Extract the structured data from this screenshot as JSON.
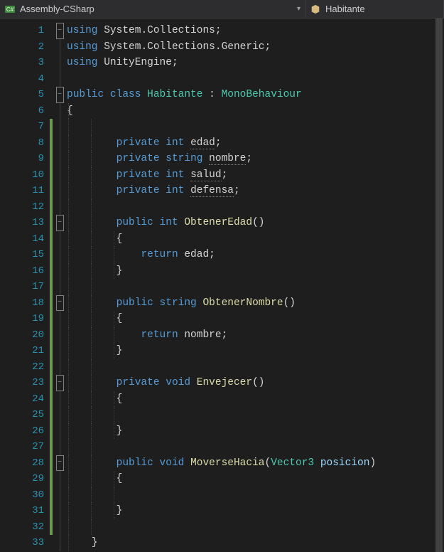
{
  "topbar": {
    "project_dropdown": "Assembly-CSharp",
    "class_dropdown": "Habitante"
  },
  "lines": [
    {
      "n": 1,
      "fold": "minus",
      "tokens": [
        [
          "kw",
          "using"
        ],
        [
          "plain",
          " System"
        ],
        [
          "punct",
          "."
        ],
        [
          "plain",
          "Collections"
        ],
        [
          "punct",
          ";"
        ]
      ]
    },
    {
      "n": 2,
      "tokens": [
        [
          "kw",
          "using"
        ],
        [
          "plain",
          " System"
        ],
        [
          "punct",
          "."
        ],
        [
          "plain",
          "Collections"
        ],
        [
          "punct",
          "."
        ],
        [
          "plain",
          "Generic"
        ],
        [
          "punct",
          ";"
        ]
      ]
    },
    {
      "n": 3,
      "tokens": [
        [
          "kw",
          "using"
        ],
        [
          "plain",
          " UnityEngine"
        ],
        [
          "punct",
          ";"
        ]
      ]
    },
    {
      "n": 4,
      "tokens": []
    },
    {
      "n": 5,
      "fold": "minus",
      "tokens": [
        [
          "kw",
          "public"
        ],
        [
          "plain",
          " "
        ],
        [
          "kw",
          "class"
        ],
        [
          "plain",
          " "
        ],
        [
          "cls",
          "Habitante"
        ],
        [
          "plain",
          " "
        ],
        [
          "punct",
          ":"
        ],
        [
          "plain",
          " "
        ],
        [
          "cls",
          "MonoBehaviour"
        ]
      ]
    },
    {
      "n": 6,
      "tokens": [
        [
          "punct",
          "{"
        ]
      ]
    },
    {
      "n": 7,
      "change": true,
      "tokens": []
    },
    {
      "n": 8,
      "change": true,
      "indent": 2,
      "tokens": [
        [
          "kw",
          "private"
        ],
        [
          "plain",
          " "
        ],
        [
          "kw",
          "int"
        ],
        [
          "plain",
          " "
        ],
        [
          "var underline-dots",
          "edad"
        ],
        [
          "punct",
          ";"
        ]
      ]
    },
    {
      "n": 9,
      "change": true,
      "indent": 2,
      "tokens": [
        [
          "kw",
          "private"
        ],
        [
          "plain",
          " "
        ],
        [
          "kw",
          "string"
        ],
        [
          "plain",
          " "
        ],
        [
          "var underline-dots",
          "nombre"
        ],
        [
          "punct",
          ";"
        ]
      ]
    },
    {
      "n": 10,
      "change": true,
      "indent": 2,
      "tokens": [
        [
          "kw",
          "private"
        ],
        [
          "plain",
          " "
        ],
        [
          "kw",
          "int"
        ],
        [
          "plain",
          " "
        ],
        [
          "var underline-dots",
          "salud"
        ],
        [
          "punct",
          ";"
        ]
      ]
    },
    {
      "n": 11,
      "change": true,
      "indent": 2,
      "tokens": [
        [
          "kw",
          "private"
        ],
        [
          "plain",
          " "
        ],
        [
          "kw",
          "int"
        ],
        [
          "plain",
          " "
        ],
        [
          "var underline-dots",
          "defensa"
        ],
        [
          "punct",
          ";"
        ]
      ]
    },
    {
      "n": 12,
      "change": true,
      "tokens": []
    },
    {
      "n": 13,
      "change": true,
      "fold": "minus",
      "indent": 2,
      "tokens": [
        [
          "kw",
          "public"
        ],
        [
          "plain",
          " "
        ],
        [
          "kw",
          "int"
        ],
        [
          "plain",
          " "
        ],
        [
          "fn-name",
          "ObtenerEdad"
        ],
        [
          "punct",
          "()"
        ]
      ]
    },
    {
      "n": 14,
      "change": true,
      "indent": 2,
      "tokens": [
        [
          "punct",
          "{"
        ]
      ]
    },
    {
      "n": 15,
      "change": true,
      "indent": 3,
      "tokens": [
        [
          "kw",
          "return"
        ],
        [
          "plain",
          " edad"
        ],
        [
          "punct",
          ";"
        ]
      ]
    },
    {
      "n": 16,
      "change": true,
      "indent": 2,
      "tokens": [
        [
          "punct",
          "}"
        ]
      ]
    },
    {
      "n": 17,
      "change": true,
      "tokens": []
    },
    {
      "n": 18,
      "change": true,
      "fold": "minus",
      "indent": 2,
      "tokens": [
        [
          "kw",
          "public"
        ],
        [
          "plain",
          " "
        ],
        [
          "kw",
          "string"
        ],
        [
          "plain",
          " "
        ],
        [
          "fn-name",
          "ObtenerNombre"
        ],
        [
          "punct",
          "()"
        ]
      ]
    },
    {
      "n": 19,
      "change": true,
      "indent": 2,
      "tokens": [
        [
          "punct",
          "{"
        ]
      ]
    },
    {
      "n": 20,
      "change": true,
      "indent": 3,
      "tokens": [
        [
          "kw",
          "return"
        ],
        [
          "plain",
          " nombre"
        ],
        [
          "punct",
          ";"
        ]
      ]
    },
    {
      "n": 21,
      "change": true,
      "indent": 2,
      "tokens": [
        [
          "punct",
          "}"
        ]
      ]
    },
    {
      "n": 22,
      "change": true,
      "tokens": []
    },
    {
      "n": 23,
      "change": true,
      "fold": "minus",
      "indent": 2,
      "tokens": [
        [
          "kw",
          "private"
        ],
        [
          "plain",
          " "
        ],
        [
          "kw",
          "void"
        ],
        [
          "plain",
          " "
        ],
        [
          "fn-name",
          "Envejecer"
        ],
        [
          "punct",
          "()"
        ]
      ]
    },
    {
      "n": 24,
      "change": true,
      "indent": 2,
      "tokens": [
        [
          "punct",
          "{"
        ]
      ]
    },
    {
      "n": 25,
      "change": true,
      "indent": 3,
      "tokens": []
    },
    {
      "n": 26,
      "change": true,
      "indent": 2,
      "tokens": [
        [
          "punct",
          "}"
        ]
      ]
    },
    {
      "n": 27,
      "change": true,
      "tokens": []
    },
    {
      "n": 28,
      "change": true,
      "fold": "minus",
      "indent": 2,
      "tokens": [
        [
          "kw",
          "public"
        ],
        [
          "plain",
          " "
        ],
        [
          "kw",
          "void"
        ],
        [
          "plain",
          " "
        ],
        [
          "fn-name",
          "MoverseHacia"
        ],
        [
          "punct",
          "("
        ],
        [
          "cls",
          "Vector3"
        ],
        [
          "plain",
          " "
        ],
        [
          "param",
          "posicion"
        ],
        [
          "punct",
          ")"
        ]
      ]
    },
    {
      "n": 29,
      "change": true,
      "indent": 2,
      "tokens": [
        [
          "punct",
          "{"
        ]
      ]
    },
    {
      "n": 30,
      "change": true,
      "indent": 3,
      "tokens": []
    },
    {
      "n": 31,
      "change": true,
      "indent": 2,
      "tokens": [
        [
          "punct",
          "}"
        ]
      ]
    },
    {
      "n": 32,
      "change": true,
      "tokens": []
    },
    {
      "n": 33,
      "indent": 1,
      "tokens": [
        [
          "punct",
          "}"
        ]
      ]
    }
  ]
}
